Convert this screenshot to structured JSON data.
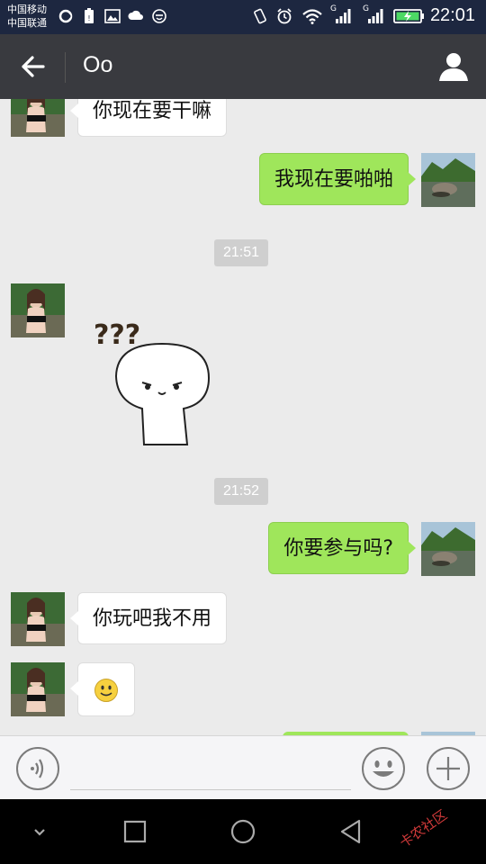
{
  "status_bar": {
    "carrier_1": "中国移动",
    "carrier_2": "中国联通",
    "network_1": "G",
    "network_2": "G",
    "time": "22:01"
  },
  "header": {
    "title": "Oo"
  },
  "messages": [
    {
      "direction": "in",
      "text": "你现在要干嘛"
    },
    {
      "direction": "out",
      "text": "我现在要啪啪"
    },
    {
      "type": "timestamp",
      "text": "21:51"
    },
    {
      "direction": "in",
      "type": "sticker",
      "sticker_text": "???"
    },
    {
      "type": "timestamp",
      "text": "21:52"
    },
    {
      "direction": "out",
      "text": "你要参与吗?"
    },
    {
      "direction": "in",
      "text": "你玩吧我不用"
    },
    {
      "direction": "in",
      "type": "emoji",
      "emoji": "smile-emoji"
    }
  ],
  "input": {
    "value": "",
    "placeholder": ""
  },
  "watermark": "卡农社区",
  "colors": {
    "status_bar": "#1d2740",
    "title_bar": "#393a3f",
    "chat_background": "#ebebeb",
    "bubble_out": "#9fe65b",
    "bubble_in": "#ffffff",
    "timestamp_bg": "#cfcfcf"
  },
  "icons": [
    "back-arrow-icon",
    "person-icon",
    "voice-icon",
    "emoji-icon",
    "plus-icon",
    "nav-down-icon",
    "nav-square-icon",
    "nav-circle-icon",
    "nav-back-icon"
  ]
}
